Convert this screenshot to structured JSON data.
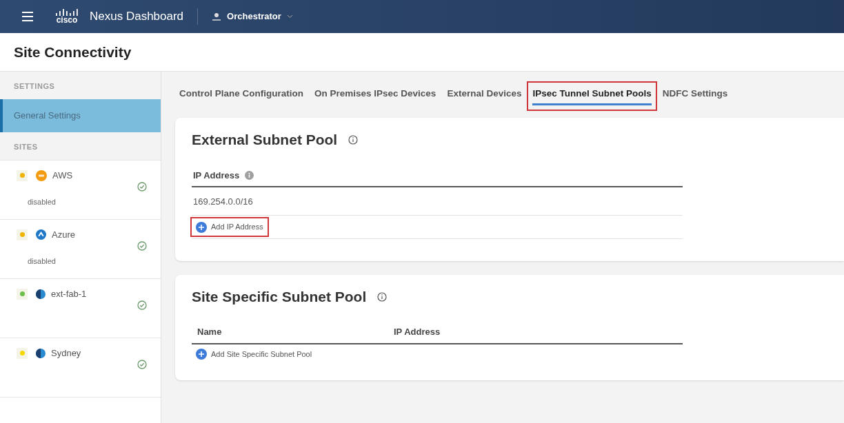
{
  "header": {
    "logo": "cisco",
    "product": "Nexus Dashboard",
    "app": "Orchestrator"
  },
  "page": {
    "title": "Site Connectivity"
  },
  "sidebar": {
    "settings_heading": "SETTINGS",
    "settings_items": [
      {
        "label": "General Settings",
        "selected": true
      }
    ],
    "sites_heading": "SITES",
    "sites": [
      {
        "name": "AWS",
        "kind": "aws",
        "color": "#f0b400",
        "status": "disabled"
      },
      {
        "name": "Azure",
        "kind": "azure",
        "color": "#f0b400",
        "status": "disabled"
      },
      {
        "name": "ext-fab-1",
        "kind": "fabric",
        "color": "#6cc04a"
      },
      {
        "name": "Sydney",
        "kind": "fabric",
        "color": "#f5d800"
      }
    ]
  },
  "tabs": [
    {
      "label": "Control Plane Configuration",
      "selected": false,
      "highlighted": false
    },
    {
      "label": "On Premises IPsec Devices",
      "selected": false,
      "highlighted": false
    },
    {
      "label": "External Devices",
      "selected": false,
      "highlighted": false
    },
    {
      "label": "IPsec Tunnel Subnet Pools",
      "selected": true,
      "highlighted": true
    },
    {
      "label": "NDFC Settings",
      "selected": false,
      "highlighted": false
    }
  ],
  "external_pool": {
    "title": "External Subnet Pool",
    "columns": [
      "IP Address"
    ],
    "rows": [
      "169.254.0.0/16"
    ],
    "add_button": {
      "label": "Add IP Address",
      "highlighted": true
    }
  },
  "site_pool": {
    "title": "Site Specific Subnet Pool",
    "columns": [
      "Name",
      "IP Address"
    ],
    "add_button": {
      "label": "Add Site Specific Subnet Pool",
      "highlighted": false
    }
  }
}
